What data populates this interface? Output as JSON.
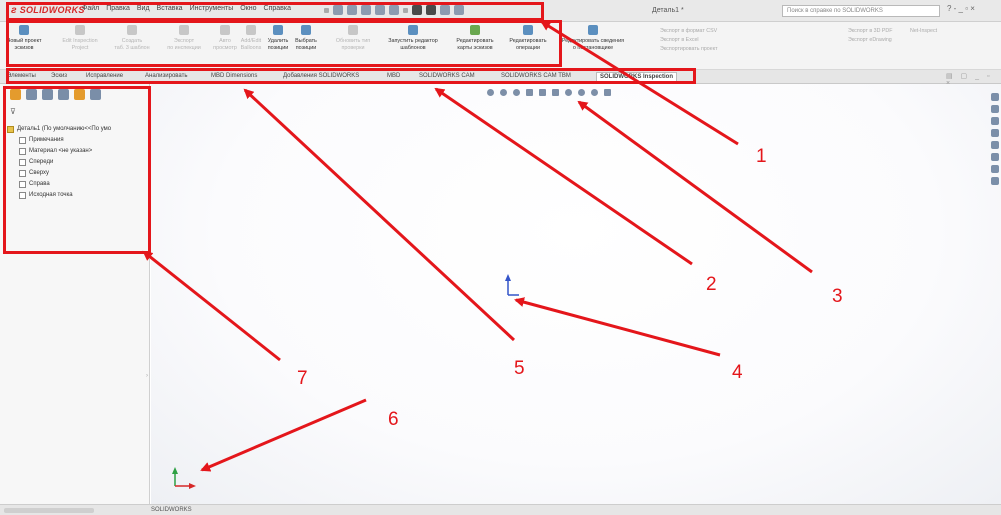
{
  "app": {
    "logo": "SOLIDWORKS",
    "menu": [
      "Файл",
      "Правка",
      "Вид",
      "Вставка",
      "Инструменты",
      "Окно",
      "Справка"
    ],
    "document_title": "Деталь1 *",
    "help_search_placeholder": "Поиск в справке по SOLIDWORKS",
    "window_controls": "? - _ ▫ ×"
  },
  "ribbon": {
    "buttons": [
      {
        "label": "Новый проект\nэскизов",
        "enabled": true
      },
      {
        "label": "Edit Inspection\nProject",
        "enabled": false
      },
      {
        "label": "Создать\nтаб. 3 шаблон",
        "enabled": false
      },
      {
        "label": "Экспорт\nпо инспекции",
        "enabled": false
      },
      {
        "label": "Авто\nпросмотр",
        "enabled": false
      },
      {
        "label": "Add/Edit\nBalloons",
        "enabled": false
      },
      {
        "label": "Удалить\nпозиции",
        "enabled": true
      },
      {
        "label": "Выбрать\nпозиции",
        "enabled": true
      },
      {
        "label": "Обновить тип\nпроверки",
        "enabled": false
      },
      {
        "label": "Запустить редактор\nшаблонов",
        "enabled": true
      },
      {
        "label": "Редактировать\nкарты эскизов",
        "enabled": true
      },
      {
        "label": "Редактировать\nоперации",
        "enabled": true
      },
      {
        "label": "Редактировать сведения\nо постановщике",
        "enabled": true
      }
    ],
    "list_col1": [
      "Экспорт в формат CSV",
      "Экспорт в Excel",
      "Экспортировать проект"
    ],
    "list_col2": [
      "Экспорт в 3D PDF",
      "Экспорт eDrawing"
    ],
    "list_col3": [
      "Net-Inspect"
    ]
  },
  "tabs": [
    {
      "label": "Элементы",
      "active": false
    },
    {
      "label": "Эскиз",
      "active": false
    },
    {
      "label": "Исправление",
      "active": false
    },
    {
      "label": "Анализировать",
      "active": false
    },
    {
      "label": "MBD Dimensions",
      "active": false
    },
    {
      "label": "Добавления SOLIDWORKS",
      "active": false
    },
    {
      "label": "MBD",
      "active": false
    },
    {
      "label": "SOLIDWORKS CAM",
      "active": false
    },
    {
      "label": "SOLIDWORKS CAM TBM",
      "active": false
    },
    {
      "label": "SOLIDWORKS Inspection",
      "active": true
    }
  ],
  "feature_tree": {
    "root": "Деталь1 (По умолчанию<<По умо",
    "items": [
      "Примечания",
      "Материал <не указан>",
      "Спереди",
      "Сверху",
      "Справа",
      "Исходная точка"
    ]
  },
  "status_bar": {
    "text": "SOLIDWORKS"
  },
  "annotations": {
    "numbers": [
      "1",
      "2",
      "3",
      "4",
      "5",
      "6",
      "7"
    ],
    "color": "#e4161b"
  },
  "colors": {
    "accent_red": "#e4161b",
    "tab_background": "#e6e6e6",
    "graphics_background": "#ffffff"
  }
}
